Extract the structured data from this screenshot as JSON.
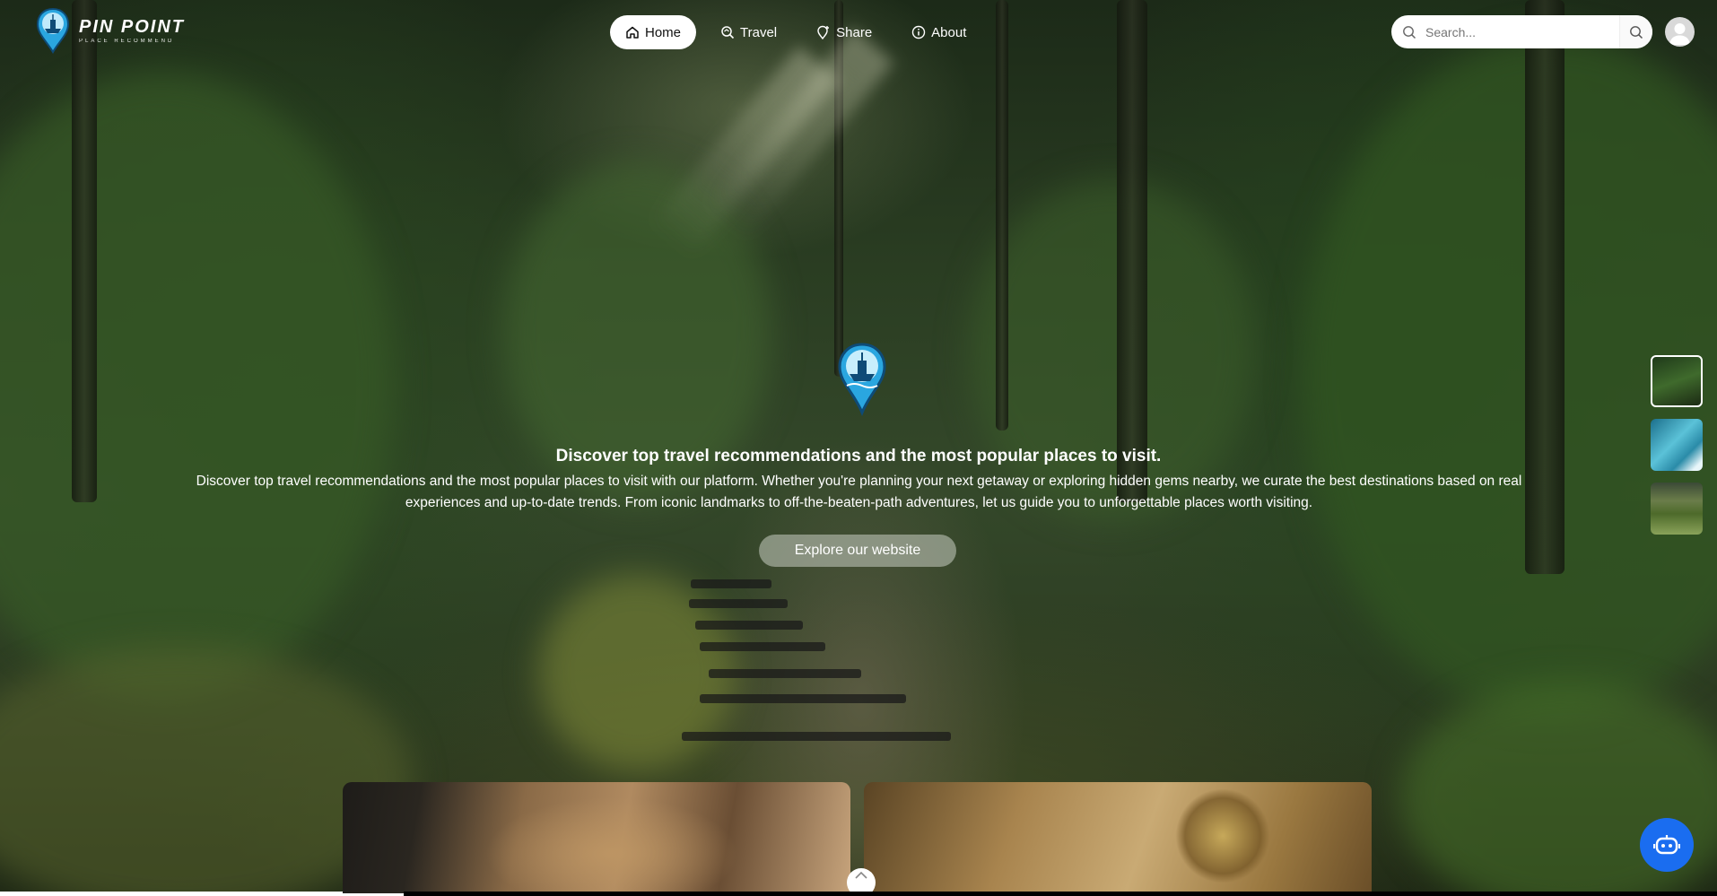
{
  "brand": {
    "title": "PIN POINT",
    "subtitle": "PLACE RECOMMEND",
    "logo_icon": "pin-ship-logo"
  },
  "nav": {
    "items": [
      {
        "label": "Home",
        "icon": "home-icon",
        "active": true
      },
      {
        "label": "Travel",
        "icon": "map-search-icon",
        "active": false
      },
      {
        "label": "Share",
        "icon": "share-pin-icon",
        "active": false
      },
      {
        "label": "About",
        "icon": "info-icon",
        "active": false
      }
    ]
  },
  "search": {
    "placeholder": "Search...",
    "value": ""
  },
  "hero": {
    "title": "Discover top travel recommendations and the most popular places to visit.",
    "description": "Discover top travel recommendations and the most popular places to visit with our platform. Whether you're planning your next getaway or exploring hidden gems nearby, we curate the best destinations based on real experiences and up-to-date trends. From iconic landmarks to off-the-beaten-path adventures, let us guide you to unforgettable places worth visiting.",
    "button_label": "Explore our website"
  },
  "thumbnails": [
    {
      "name": "forest",
      "active": true
    },
    {
      "name": "ocean",
      "active": false
    },
    {
      "name": "village",
      "active": false
    }
  ],
  "colors": {
    "accent": "#1a6df0",
    "logo_blue": "#2aa6e0",
    "text_light": "#ffffff"
  }
}
